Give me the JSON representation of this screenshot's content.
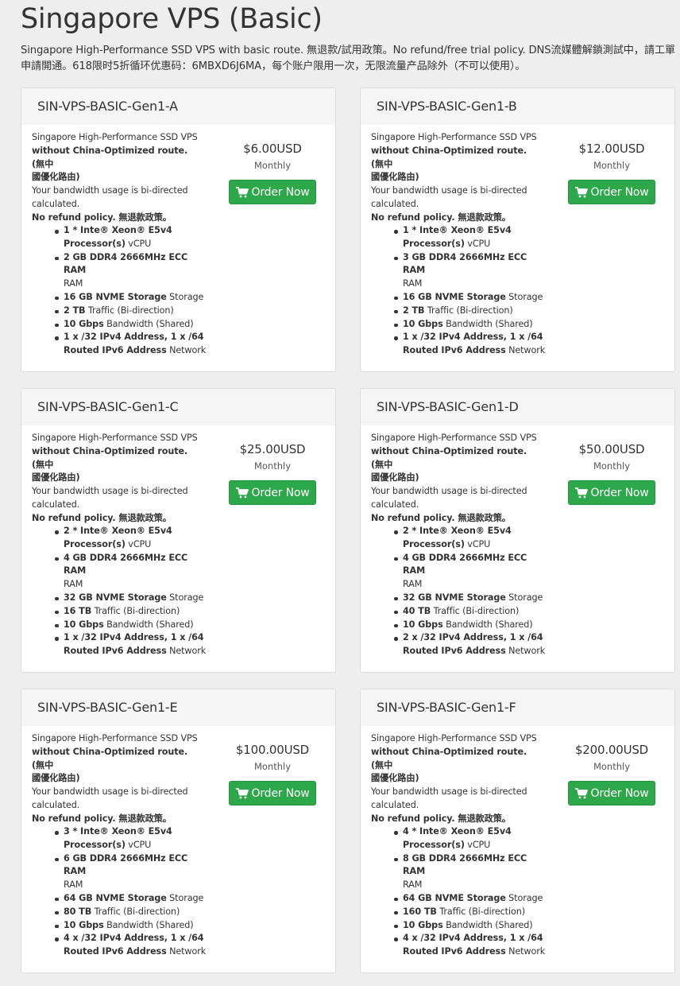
{
  "page": {
    "title": "Singapore VPS (Basic)",
    "description": "Singapore High-Performance SSD VPS with basic route. 無退款/試用政策。No refund/free trial policy. DNS流媒體解鎖測試中，請工單申請開通。618限时5折循环优惠码：6MBXD6J6MA，每个账户限用一次，无限流量产品除外（不可以使用）。"
  },
  "common": {
    "desc_line1": "Singapore High-Performance SSD VPS",
    "desc_line2": "without China-Optimized route. (無中",
    "desc_line3": "國優化路由)",
    "desc_line4": "Your bandwidth usage is bi-directed",
    "desc_line5": "calculated.",
    "desc_line6": "No refund policy. 無退款政策。",
    "cycle": "Monthly",
    "order_label": "Order Now"
  },
  "products": [
    {
      "name": "SIN-VPS-BASIC-Gen1-A",
      "price": "$6.00USD",
      "f1a": "1 * Inte® Xeon® E5v4",
      "f1b": "Processor(s)",
      "f1c": " vCPU",
      "f2a": "2 GB DDR4 2666MHz ECC RAM",
      "f2b": "RAM",
      "f3a": "16 GB NVME Storage",
      "f3b": " Storage",
      "f4a": "2 TB",
      "f4b": " Traffic (Bi-direction)",
      "f5a": "10 Gbps",
      "f5b": " Bandwidth (Shared)",
      "f6a": "1 x /32 IPv4 Address, 1 x /64",
      "f6b": "Routed IPv6 Address",
      "f6c": " Network"
    },
    {
      "name": "SIN-VPS-BASIC-Gen1-B",
      "price": "$12.00USD",
      "f1a": "1 * Inte® Xeon® E5v4",
      "f1b": "Processor(s)",
      "f1c": " vCPU",
      "f2a": "3 GB DDR4 2666MHz ECC RAM",
      "f2b": "RAM",
      "f3a": "16 GB NVME Storage",
      "f3b": " Storage",
      "f4a": "2 TB",
      "f4b": " Traffic (Bi-direction)",
      "f5a": "10 Gbps",
      "f5b": " Bandwidth (Shared)",
      "f6a": "1 x /32 IPv4 Address, 1 x /64",
      "f6b": "Routed IPv6 Address",
      "f6c": " Network"
    },
    {
      "name": "SIN-VPS-BASIC-Gen1-C",
      "price": "$25.00USD",
      "f1a": "2 * Inte® Xeon® E5v4",
      "f1b": "Processor(s)",
      "f1c": " vCPU",
      "f2a": "4 GB DDR4 2666MHz ECC RAM",
      "f2b": "RAM",
      "f3a": "32 GB NVME Storage",
      "f3b": " Storage",
      "f4a": "16 TB",
      "f4b": " Traffic (Bi-direction)",
      "f5a": "10 Gbps",
      "f5b": " Bandwidth (Shared)",
      "f6a": "1 x /32 IPv4 Address, 1 x /64",
      "f6b": "Routed IPv6 Address",
      "f6c": " Network"
    },
    {
      "name": "SIN-VPS-BASIC-Gen1-D",
      "price": "$50.00USD",
      "f1a": "2 * Inte® Xeon® E5v4",
      "f1b": "Processor(s)",
      "f1c": " vCPU",
      "f2a": "4 GB DDR4 2666MHz ECC RAM",
      "f2b": "RAM",
      "f3a": "32 GB NVME Storage",
      "f3b": " Storage",
      "f4a": "40 TB",
      "f4b": " Traffic (Bi-direction)",
      "f5a": "10 Gbps",
      "f5b": " Bandwidth (Shared)",
      "f6a": "2 x /32 IPv4 Address, 1 x /64",
      "f6b": "Routed IPv6 Address",
      "f6c": " Network"
    },
    {
      "name": "SIN-VPS-BASIC-Gen1-E",
      "price": "$100.00USD",
      "f1a": "3 * Inte® Xeon® E5v4",
      "f1b": "Processor(s)",
      "f1c": " vCPU",
      "f2a": "6 GB DDR4 2666MHz ECC RAM",
      "f2b": "RAM",
      "f3a": "64 GB NVME Storage",
      "f3b": " Storage",
      "f4a": "80 TB",
      "f4b": " Traffic (Bi-direction)",
      "f5a": "10 Gbps",
      "f5b": " Bandwidth (Shared)",
      "f6a": "4 x /32 IPv4 Address, 1 x /64",
      "f6b": "Routed IPv6 Address",
      "f6c": " Network"
    },
    {
      "name": "SIN-VPS-BASIC-Gen1-F",
      "price": "$200.00USD",
      "f1a": "4 * Inte® Xeon® E5v4",
      "f1b": "Processor(s)",
      "f1c": " vCPU",
      "f2a": "8 GB DDR4 2666MHz ECC RAM",
      "f2b": "RAM",
      "f3a": "64 GB NVME Storage",
      "f3b": " Storage",
      "f4a": "160 TB",
      "f4b": " Traffic (Bi-direction)",
      "f5a": "10 Gbps",
      "f5b": " Bandwidth (Shared)",
      "f6a": "4 x /32 IPv4 Address, 1 x /64",
      "f6b": "Routed IPv6 Address",
      "f6c": " Network"
    }
  ],
  "colors": {
    "accent": "#2ca84a",
    "card_header": "#f5f5f5",
    "background": "#eeeeee"
  },
  "icons": {
    "order": "shopping-cart-icon"
  }
}
